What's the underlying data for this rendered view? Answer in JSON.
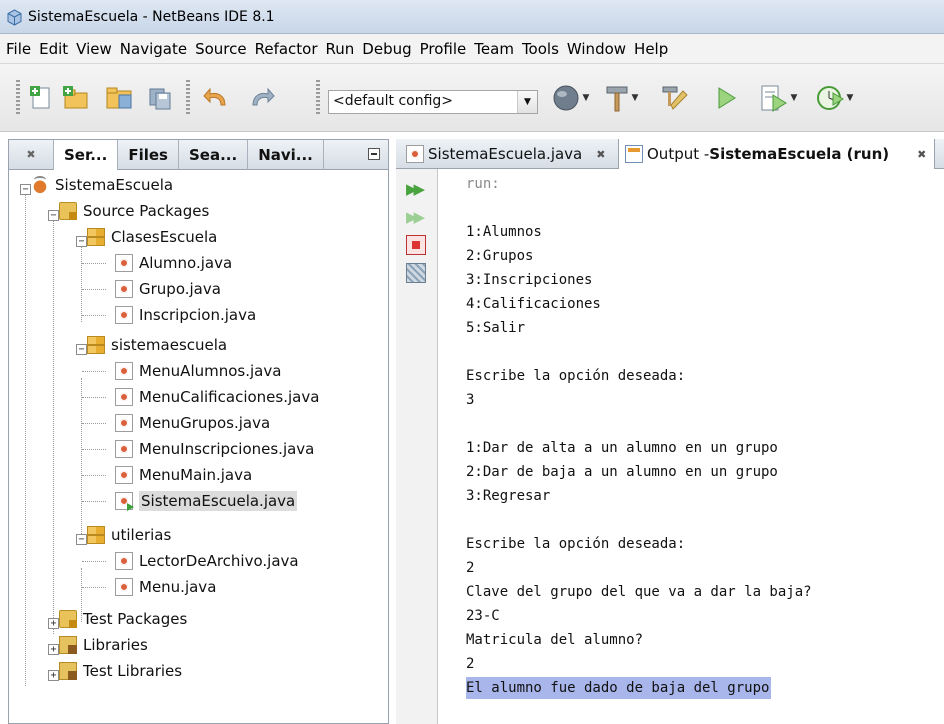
{
  "window": {
    "title": "SistemaEscuela - NetBeans IDE 8.1"
  },
  "menu": [
    "File",
    "Edit",
    "View",
    "Navigate",
    "Source",
    "Refactor",
    "Run",
    "Debug",
    "Profile",
    "Team",
    "Tools",
    "Window",
    "Help"
  ],
  "toolbar": {
    "config": "<default config>"
  },
  "left_panel": {
    "tabs": [
      "Ser...",
      "Files",
      "Sea...",
      "Navi..."
    ],
    "tree": {
      "project": "SistemaEscuela",
      "source_packages": "Source Packages",
      "packages": [
        {
          "name": "ClasesEscuela",
          "files": [
            "Alumno.java",
            "Grupo.java",
            "Inscripcion.java"
          ]
        },
        {
          "name": "sistemaescuela",
          "files": [
            "MenuAlumnos.java",
            "MenuCalificaciones.java",
            "MenuGrupos.java",
            "MenuInscripciones.java",
            "MenuMain.java",
            "SistemaEscuela.java"
          ]
        },
        {
          "name": "utilerias",
          "files": [
            "LectorDeArchivo.java",
            "Menu.java"
          ]
        }
      ],
      "test_packages": "Test Packages",
      "libraries": "Libraries",
      "test_libraries": "Test Libraries"
    }
  },
  "right_panel": {
    "editor_tab": "SistemaEscuela.java",
    "output_tab_prefix": "Output - ",
    "output_tab_name": "SistemaEscuela (run)",
    "output_lines": [
      "run:",
      "",
      "1:Alumnos",
      "2:Grupos",
      "3:Inscripciones",
      "4:Calificaciones",
      "5:Salir",
      "",
      "Escribe la opción deseada:",
      "3",
      "",
      "1:Dar de alta a un alumno en un grupo",
      "2:Dar de baja a un alumno en un grupo",
      "3:Regresar",
      "",
      "Escribe la opción deseada:",
      "2",
      "Clave del grupo del que va a dar la baja?",
      "23-C",
      "Matricula del alumno?",
      "2",
      "El alumno fue dado de baja del grupo"
    ]
  }
}
